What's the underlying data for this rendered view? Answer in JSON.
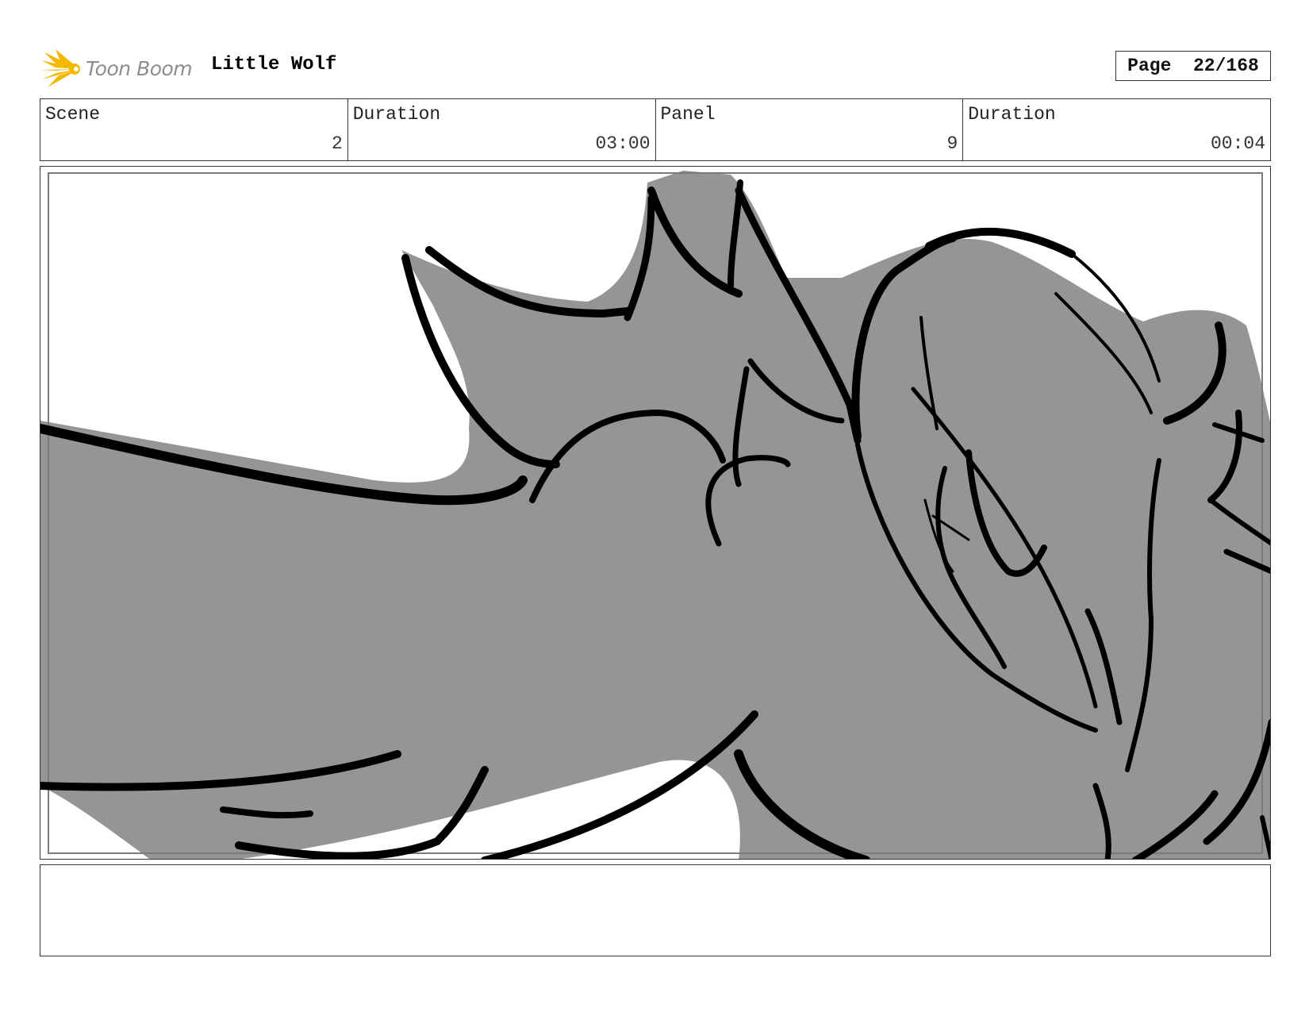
{
  "header": {
    "brand_name": "Toon Boom",
    "project_title": "Little Wolf",
    "page_label": "Page",
    "page_value": "22/168"
  },
  "info": {
    "scene_label": "Scene",
    "scene_value": "2",
    "scene_duration_label": "Duration",
    "scene_duration_value": "03:00",
    "panel_label": "Panel",
    "panel_value": "9",
    "panel_duration_label": "Duration",
    "panel_duration_value": "00:04"
  },
  "panel": {
    "fill_color": "#959595",
    "line_color": "#000000"
  },
  "notes": {
    "text": ""
  }
}
